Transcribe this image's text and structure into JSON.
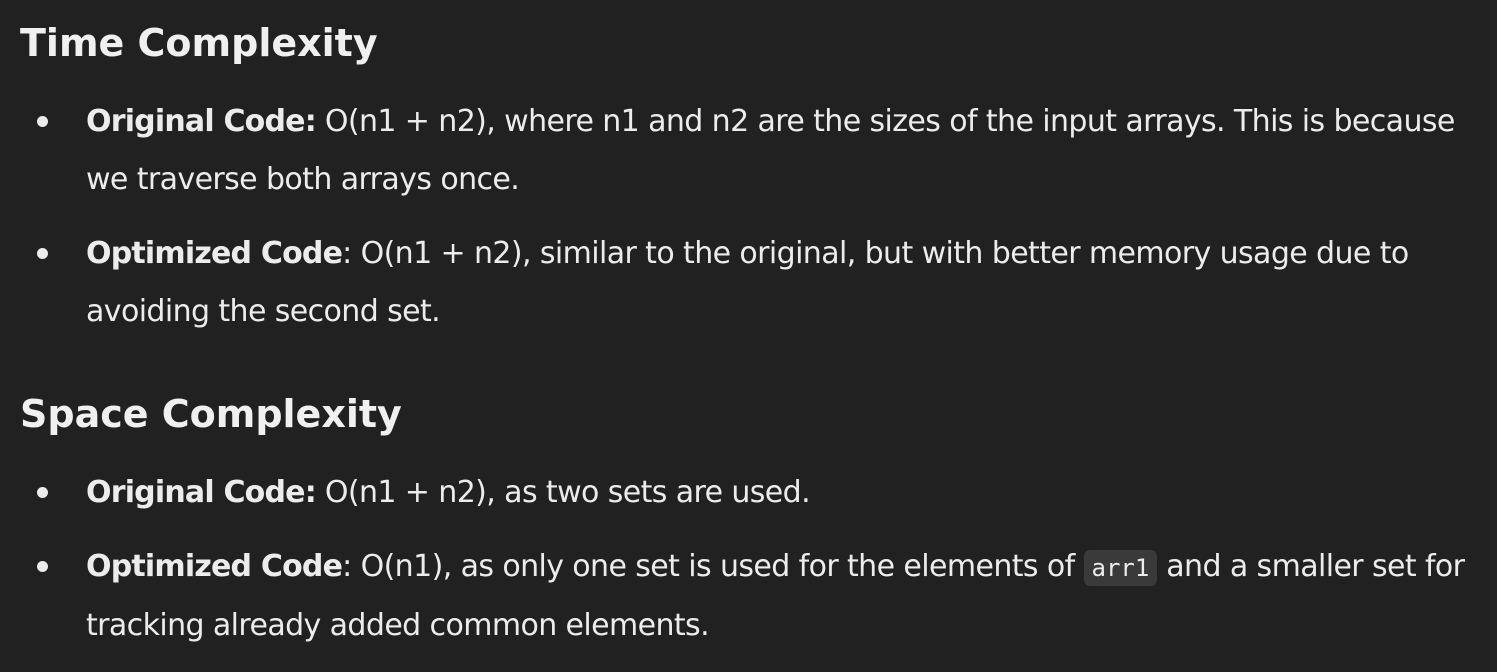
{
  "time": {
    "heading": "Time Complexity",
    "items": [
      {
        "label": "Original Code:",
        "text": " O(n1 + n2), where n1 and n2 are the sizes of the input arrays. This is because we traverse both arrays once."
      },
      {
        "label": "Optimized Code",
        "text": ": O(n1 + n2), similar to the original, but with better memory usage due to avoiding the second set."
      }
    ]
  },
  "space": {
    "heading": "Space Complexity",
    "items": [
      {
        "label": "Original Code:",
        "text": " O(n1 + n2), as two sets are used."
      },
      {
        "label": "Optimized Code",
        "text_before": ": O(n1), as only one set is used for the elements of ",
        "code": "arr1",
        "text_after": " and a smaller set for tracking already added common elements."
      }
    ]
  }
}
